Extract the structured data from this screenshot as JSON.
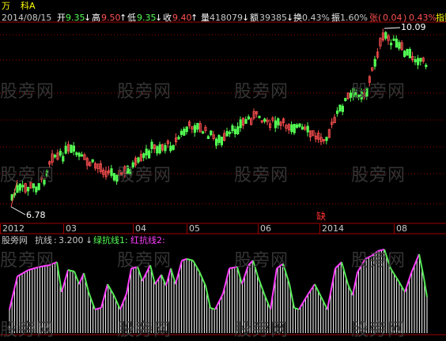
{
  "header": {
    "stock_code": "万",
    "stock_name": "科A",
    "date": "2014/08/15",
    "open": {
      "label": "开",
      "value": "9.35",
      "arrow": "↓"
    },
    "high": {
      "label": "高",
      "value": "9.50",
      "arrow": "↑"
    },
    "low": {
      "label": "低",
      "value": "9.35",
      "arrow": "↓"
    },
    "close": {
      "label": "收",
      "value": "9.40",
      "arrow": "↑"
    },
    "volume": {
      "label": "量",
      "value": "418079",
      "arrow": "↓"
    },
    "amount": {
      "label": "额",
      "value": "39385",
      "arrow": "↓"
    },
    "turnover": {
      "label": "换",
      "value": "0.43%"
    },
    "amplitude": {
      "label": "振",
      "value": "1.60%"
    },
    "change": {
      "label": "张",
      "value": "0.04",
      "pct": "0.43%"
    },
    "indicator": "指数"
  },
  "watermark": "股旁网",
  "price_labels": {
    "high": "10.09",
    "low": "6.78"
  },
  "x_axis": {
    "labels": [
      "2012",
      "03",
      "04",
      "05",
      "06",
      "2014",
      "08"
    ],
    "marker": "缺"
  },
  "sub_panel": {
    "title": "股旁网",
    "indicator_name": "抗线",
    "indicator_value": "3.200",
    "indicator_arrow": "↓",
    "green_label": "绿抗线1:",
    "red_label": "红抗线2:"
  },
  "colors": {
    "background": "#000000",
    "up_candle": "#ff5050",
    "down_candle": "#54ff54",
    "grid": "#a00000",
    "green_line": "#54e854",
    "magenta_line": "#ff40ff",
    "bars": "#ffffff"
  }
}
